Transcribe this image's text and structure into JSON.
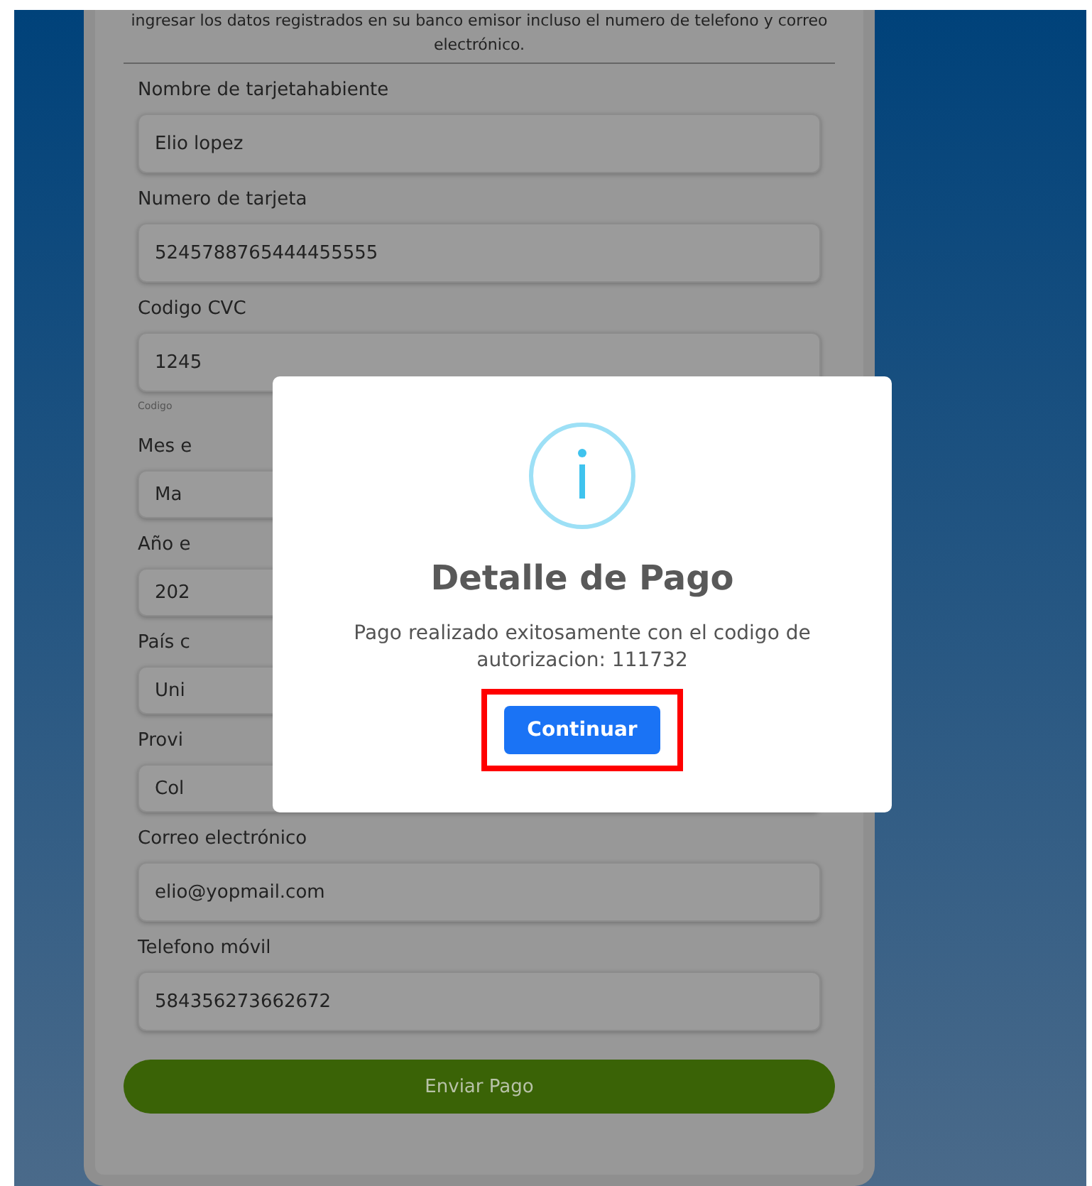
{
  "form": {
    "intro": [
      "ingresar los datos registrados en su banco emisor incluso el numero de telefono y correo",
      "electrónico."
    ],
    "fields": [
      {
        "label": "Nombre de tarjetahabiente",
        "value": "Elio lopez",
        "kind": "input"
      },
      {
        "label": "Numero de tarjeta",
        "value": "5245788765444455555",
        "kind": "input"
      },
      {
        "label": "Codigo CVC",
        "value": "1245",
        "kind": "input",
        "hint": "Codigo"
      },
      {
        "label": "Mes e",
        "value": "Ma",
        "kind": "select"
      },
      {
        "label": "Año e",
        "value": "202",
        "kind": "select"
      },
      {
        "label": "País c",
        "value": "Uni",
        "kind": "select"
      },
      {
        "label": "Provi",
        "value": "Col",
        "kind": "select"
      },
      {
        "label": "Correo electrónico",
        "value": "elio@yopmail.com",
        "kind": "input"
      },
      {
        "label": "Telefono móvil",
        "value": "584356273662672",
        "kind": "input"
      }
    ],
    "submit": "Enviar Pago"
  },
  "dialog": {
    "title": "Detalle de Pago",
    "message": "Pago realizado exitosamente con el codigo de autorizacion: 111732",
    "button": "Continuar",
    "highlighted": true
  }
}
